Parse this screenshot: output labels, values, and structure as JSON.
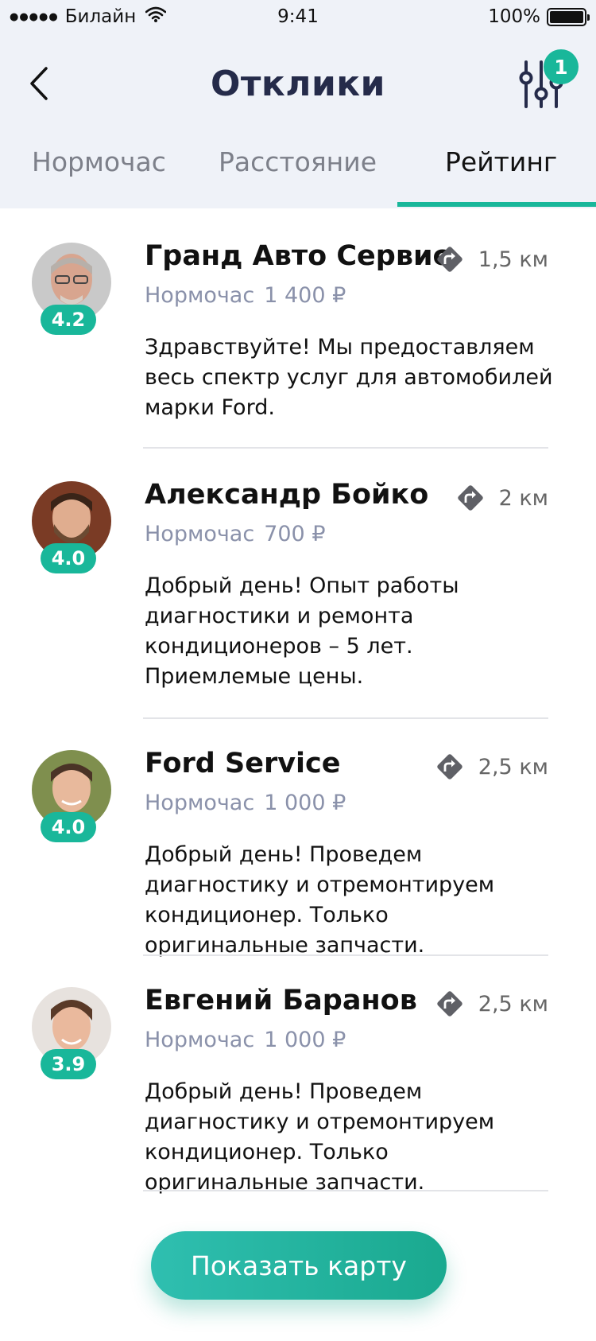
{
  "status_bar": {
    "carrier": "Билайн",
    "time": "9:41",
    "battery": "100%"
  },
  "header": {
    "title": "Отклики",
    "filter_badge": "1"
  },
  "tabs": [
    {
      "label": "Нормочас",
      "active": false
    },
    {
      "label": "Расстояние",
      "active": false
    },
    {
      "label": "Рейтинг",
      "active": true
    }
  ],
  "responses": [
    {
      "name": "Гранд Авто Сервис",
      "rating": "4.2",
      "rate_label": "Нормочас",
      "rate_value": "1 400 ₽",
      "distance": "1,5 км",
      "description": "Здравствуйте! Мы предоставляем весь спектр услуг для автомобилей марки Ford."
    },
    {
      "name": "Александр Бойко",
      "rating": "4.0",
      "rate_label": "Нормочас",
      "rate_value": "700 ₽",
      "distance": "2 км",
      "description": "Добрый день! Опыт работы диагностики и ремонта кондиционеров – 5 лет. Приемлемые цены."
    },
    {
      "name": "Ford Service",
      "rating": "4.0",
      "rate_label": "Нормочас",
      "rate_value": "1 000 ₽",
      "distance": "2,5 км",
      "description": "Добрый день! Проведем диагностику и отремонтируем кондиционер. Только оригинальные запчасти."
    },
    {
      "name": "Евгений Баранов",
      "rating": "3.9",
      "rate_label": "Нормочас",
      "rate_value": "1 000 ₽",
      "distance": "2,5 км",
      "description": "Добрый день! Проведем диагностику и отремонтируем кондиционер. Только оригинальные запчасти."
    }
  ],
  "map_button": {
    "label": "Показать карту"
  },
  "colors": {
    "accent": "#19b79a",
    "header_bg": "#eff2f8",
    "title": "#252b4a",
    "rate_text": "#8a91aa"
  }
}
